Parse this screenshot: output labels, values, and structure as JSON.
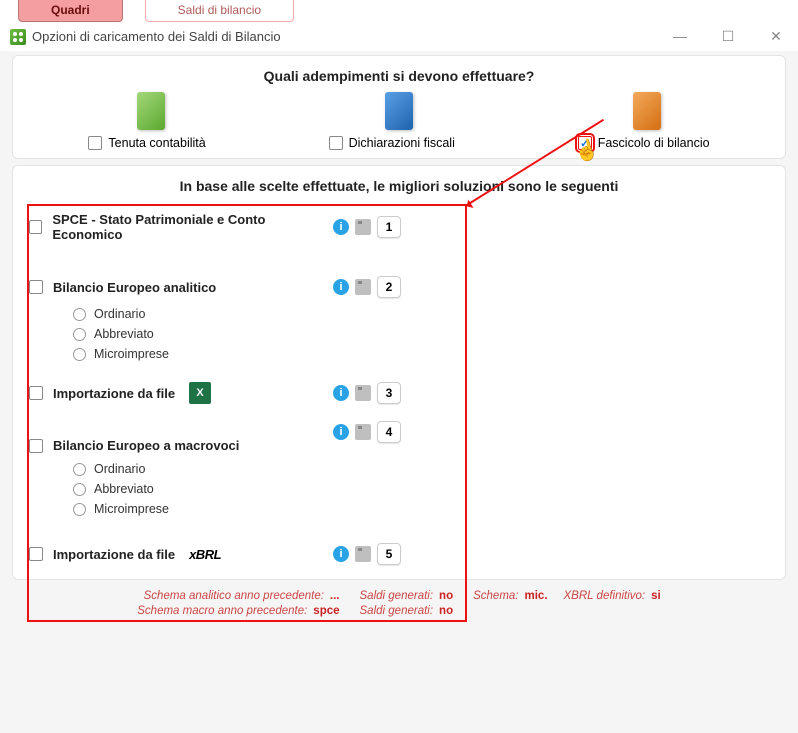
{
  "tabs": {
    "quadri": "Quadri",
    "saldi": "Saldi di bilancio"
  },
  "window": {
    "title": "Opzioni di caricamento dei Saldi di Bilancio"
  },
  "section1": {
    "heading": "Quali adempimenti si devono effettuare?",
    "opt1": "Tenuta contabilità",
    "opt2": "Dichiarazioni fiscali",
    "opt3": "Fascicolo di bilancio"
  },
  "section2": {
    "heading": "In base alle scelte effettuate, le migliori soluzioni sono le seguenti",
    "items": [
      {
        "label": "SPCE  -  Stato Patrimoniale e Conto Economico",
        "num": "1"
      },
      {
        "label": "Bilancio Europeo analitico",
        "num": "2",
        "subs": [
          "Ordinario",
          "Abbreviato",
          "Microimprese"
        ]
      },
      {
        "label": "Importazione da file",
        "num": "3",
        "badge": "excel"
      },
      {
        "label": "Bilancio Europeo a macrovoci",
        "num": "4",
        "subs": [
          "Ordinario",
          "Abbreviato",
          "Microimprese"
        ]
      },
      {
        "label": "Importazione da file",
        "num": "5",
        "badge": "xbrl"
      }
    ]
  },
  "footer": {
    "l1a": "Schema analitico anno precedente:",
    "l1b": "...",
    "l2a": "Schema macro anno precedente:",
    "l2b": "spce",
    "m1a": "Saldi generati:",
    "m1b": "no",
    "m2a": "Saldi generati:",
    "m2b": "no",
    "r1a": "Schema:",
    "r1b": "mic.",
    "r2a": "XBRL definitivo:",
    "r2b": "si"
  }
}
